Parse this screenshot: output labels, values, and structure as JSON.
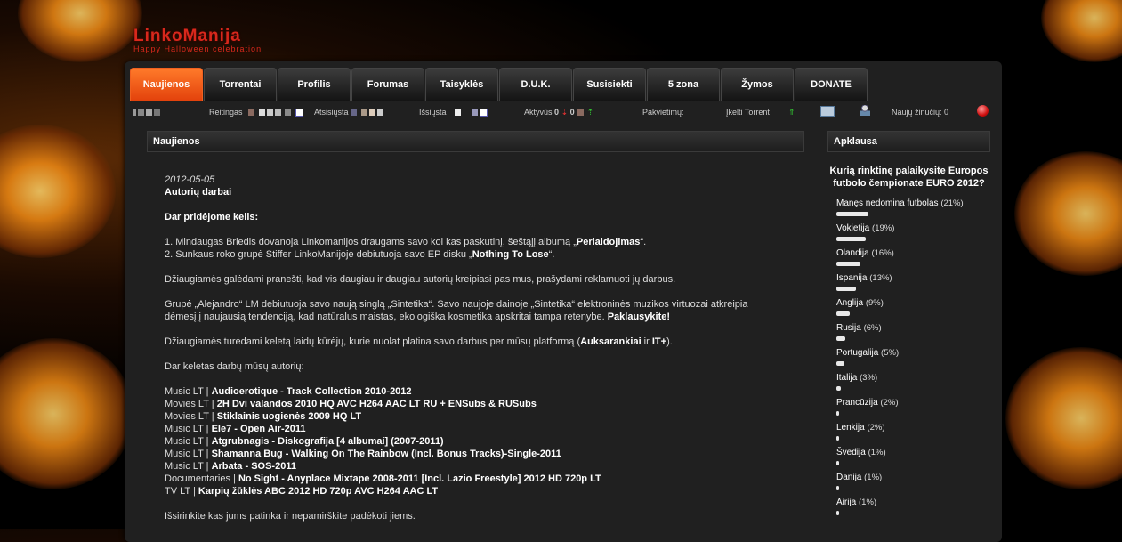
{
  "site": {
    "logo": "LinkoManija",
    "tagline": "Happy Halloween celebration"
  },
  "tabs": [
    {
      "label": "Naujienos",
      "active": true
    },
    {
      "label": "Torrentai"
    },
    {
      "label": "Profilis"
    },
    {
      "label": "Forumas"
    },
    {
      "label": "Taisyklės"
    },
    {
      "label": "D.U.K."
    },
    {
      "label": "Susisiekti"
    },
    {
      "label": "5 zona"
    },
    {
      "label": "Žymos"
    },
    {
      "label": "DONATE"
    }
  ],
  "stats": {
    "reitingas": "Reitingas",
    "atsisiusta": "Atsisiųsta",
    "issiusta": "Išsiųsta",
    "aktyvus": "Aktyvūs",
    "aktyvus_count": "0",
    "aktyvus_count2": "0",
    "pakvietimu": "Pakvietimų:",
    "ikelti": "Įkelti Torrent",
    "nauju_zinuciu": "Naujų žinučių: 0"
  },
  "news": {
    "header": "Naujienos",
    "date": "2012-05-05",
    "title": "Autorių darbai",
    "added": "Dar pridėjome kelis:",
    "item1_pre": "1. Mindaugas Briedis dovanoja Linkomanijos draugams savo kol kas paskutinį, šeštąjį albumą „",
    "item1_bold": "Perlaidojimas",
    "item1_post": "“.",
    "item2_pre": "2. Sunkaus roko grupė Stiffer LinkoManijoje debiutuoja savo EP disku „",
    "item2_bold": "Nothing To Lose",
    "item2_post": "“.",
    "p1": "Džiaugiamės galėdami pranešti, kad vis daugiau ir daugiau autorių kreipiasi pas mus, prašydami reklamuoti jų darbus.",
    "p2_line1": "Grupė „Alejandro“ LM debiutuoja savo naują singlą „Sintetika“. Savo naujoje dainoje „Sintetika“ elektroninės muzikos virtuozai atkreipia",
    "p2_line2": "dėmesį į naujausią tendenciją, kad natūralus maistas, ekologiška kosmetika apskritai tampa retenybe. ",
    "p2_bold": "Paklausykite!",
    "p3_pre": "Džiaugiamės turėdami keletą laidų kūrėjų, kurie nuolat platina savo darbus per mūsų platformą (",
    "p3_b1": "Auksarankiai",
    "p3_mid": " ir ",
    "p3_b2": "IT+",
    "p3_post": ").",
    "list_intro": "Dar keletas darbų mūsų autorių:",
    "releases": [
      {
        "cat": "Music LT | ",
        "title": "Audioerotique - Track Collection 2010-2012"
      },
      {
        "cat": "Movies LT | ",
        "title": "2H Dvi valandos 2010 HQ AVC H264 AAC LT RU + ENSubs & RUSubs"
      },
      {
        "cat": "Movies LT | ",
        "title": "Stiklainis uogienės 2009 HQ LT"
      },
      {
        "cat": "Music LT | ",
        "title": "Ele7 - Open Air-2011"
      },
      {
        "cat": "Music LT | ",
        "title": "Atgrubnagis - Diskografija [4 albumai] (2007-2011)"
      },
      {
        "cat": "Music LT | ",
        "title": "Shamanna Bug - Walking On The Rainbow (Incl. Bonus Tracks)-Single-2011"
      },
      {
        "cat": "Music LT | ",
        "title": "Arbata - SOS-2011"
      },
      {
        "cat": "Documentaries | ",
        "title": "No Sight - Anyplace Mixtape 2008-2011 [Incl. Lazio Freestyle] 2012 HD 720p LT"
      },
      {
        "cat": "TV LT | ",
        "title": "Karpių žūklės ABC 2012 HD 720p AVC H264 AAC LT"
      }
    ],
    "closing": "Išsirinkite kas jums patinka ir nepamirškite padėkoti jiems."
  },
  "poll": {
    "header": "Apklausa",
    "question": "Kurią rinktinę palaikysite Europos futbolo čempionate EURO 2012?",
    "options": [
      {
        "label": "Manęs nedomina futbolas",
        "pct": "(21%)",
        "value": 21
      },
      {
        "label": "Vokietija",
        "pct": "(19%)",
        "value": 19
      },
      {
        "label": "Olandija",
        "pct": "(16%)",
        "value": 16
      },
      {
        "label": "Ispanija",
        "pct": "(13%)",
        "value": 13
      },
      {
        "label": "Anglija",
        "pct": "(9%)",
        "value": 9
      },
      {
        "label": "Rusija",
        "pct": "(6%)",
        "value": 6
      },
      {
        "label": "Portugalija",
        "pct": "(5%)",
        "value": 5
      },
      {
        "label": "Italija",
        "pct": "(3%)",
        "value": 3
      },
      {
        "label": "Prancūzija",
        "pct": "(2%)",
        "value": 2
      },
      {
        "label": "Lenkija",
        "pct": "(2%)",
        "value": 2
      },
      {
        "label": "Švedija",
        "pct": "(1%)",
        "value": 1
      },
      {
        "label": "Danija",
        "pct": "(1%)",
        "value": 1
      },
      {
        "label": "Airija",
        "pct": "(1%)",
        "value": 1
      }
    ]
  }
}
